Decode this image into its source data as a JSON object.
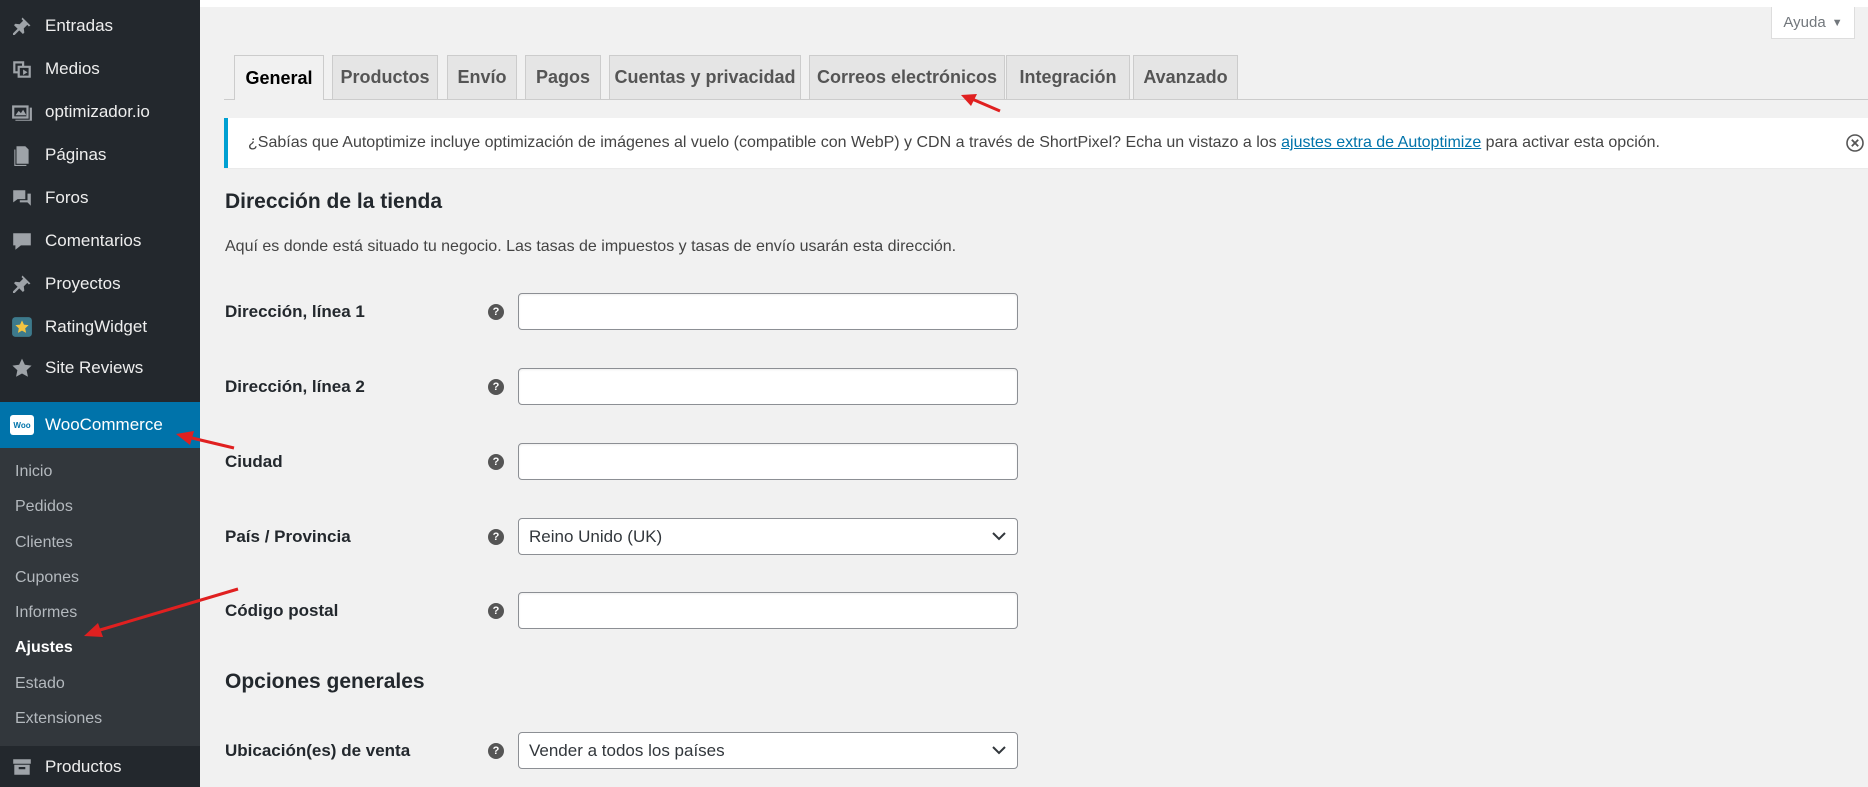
{
  "sidebar": {
    "items": [
      {
        "label": "Entradas",
        "icon": "pushpin-icon"
      },
      {
        "label": "Medios",
        "icon": "media-icon"
      },
      {
        "label": "optimizador.io",
        "icon": "images-icon"
      },
      {
        "label": "Páginas",
        "icon": "pages-icon"
      },
      {
        "label": "Foros",
        "icon": "forums-icon"
      },
      {
        "label": "Comentarios",
        "icon": "comments-icon"
      },
      {
        "label": "Proyectos",
        "icon": "pushpin-icon"
      },
      {
        "label": "RatingWidget",
        "icon": "star-badge-icon"
      },
      {
        "label": "Site Reviews",
        "icon": "star-icon"
      },
      {
        "label": "WooCommerce",
        "icon": "woo-logo-icon"
      }
    ],
    "woo_logo_text": "Woo",
    "submenu": [
      "Inicio",
      "Pedidos",
      "Clientes",
      "Cupones",
      "Informes",
      "Ajustes",
      "Estado",
      "Extensiones"
    ],
    "submenu_current": "Ajustes",
    "bottom_item": {
      "label": "Productos",
      "icon": "archive-icon"
    }
  },
  "help": {
    "label": "Ayuda",
    "caret": "▼"
  },
  "tabs": [
    {
      "label": "General",
      "active": true
    },
    {
      "label": "Productos"
    },
    {
      "label": "Envío"
    },
    {
      "label": "Pagos"
    },
    {
      "label": "Cuentas y privacidad"
    },
    {
      "label": "Correos electrónicos"
    },
    {
      "label": "Integración"
    },
    {
      "label": "Avanzado"
    }
  ],
  "notice": {
    "before": "¿Sabías que Autoptimize incluye optimización de imágenes al vuelo (compatible con WebP) y CDN a través de ShortPixel? Echa un vistazo a los ",
    "link": "ajustes extra de Autoptimize",
    "after": " para activar esta opción."
  },
  "store_address": {
    "title": "Dirección de la tienda",
    "description": "Aquí es donde está situado tu negocio. Las tasas de impuestos y tasas de envío usarán esta dirección.",
    "fields": {
      "address1": {
        "label": "Dirección, línea 1",
        "value": ""
      },
      "address2": {
        "label": "Dirección, línea 2",
        "value": ""
      },
      "city": {
        "label": "Ciudad",
        "value": ""
      },
      "country": {
        "label": "País / Provincia",
        "value": "Reino Unido (UK)"
      },
      "postcode": {
        "label": "Código postal",
        "value": ""
      }
    }
  },
  "general_options": {
    "title": "Opciones generales",
    "selling_location": {
      "label": "Ubicación(es) de venta",
      "value": "Vender a todos los países"
    }
  },
  "help_glyph": "?",
  "colors": {
    "sidebar": "#23282d",
    "submenu": "#32373c",
    "accent": "#0073aa",
    "notice_border": "#00a0d2",
    "annotation_arrow": "#e02020"
  }
}
